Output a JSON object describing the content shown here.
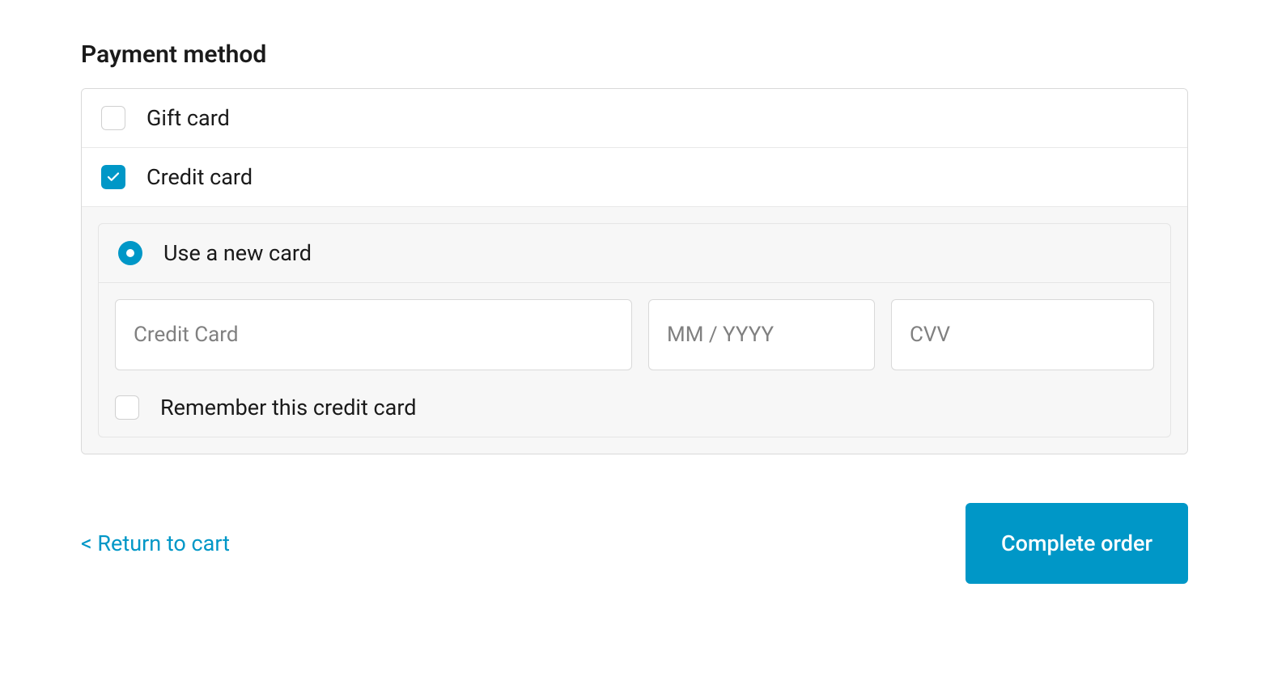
{
  "section_title": "Payment method",
  "options": {
    "gift_card": {
      "label": "Gift card",
      "checked": false
    },
    "credit_card": {
      "label": "Credit card",
      "checked": true
    }
  },
  "card_form": {
    "new_card_label": "Use a new card",
    "new_card_selected": true,
    "card_number_placeholder": "Credit Card",
    "expiry_placeholder": "MM / YYYY",
    "cvv_placeholder": "CVV",
    "remember_label": "Remember this credit card",
    "remember_checked": false
  },
  "footer": {
    "return_link": "< Return to cart",
    "complete_button": "Complete order"
  }
}
